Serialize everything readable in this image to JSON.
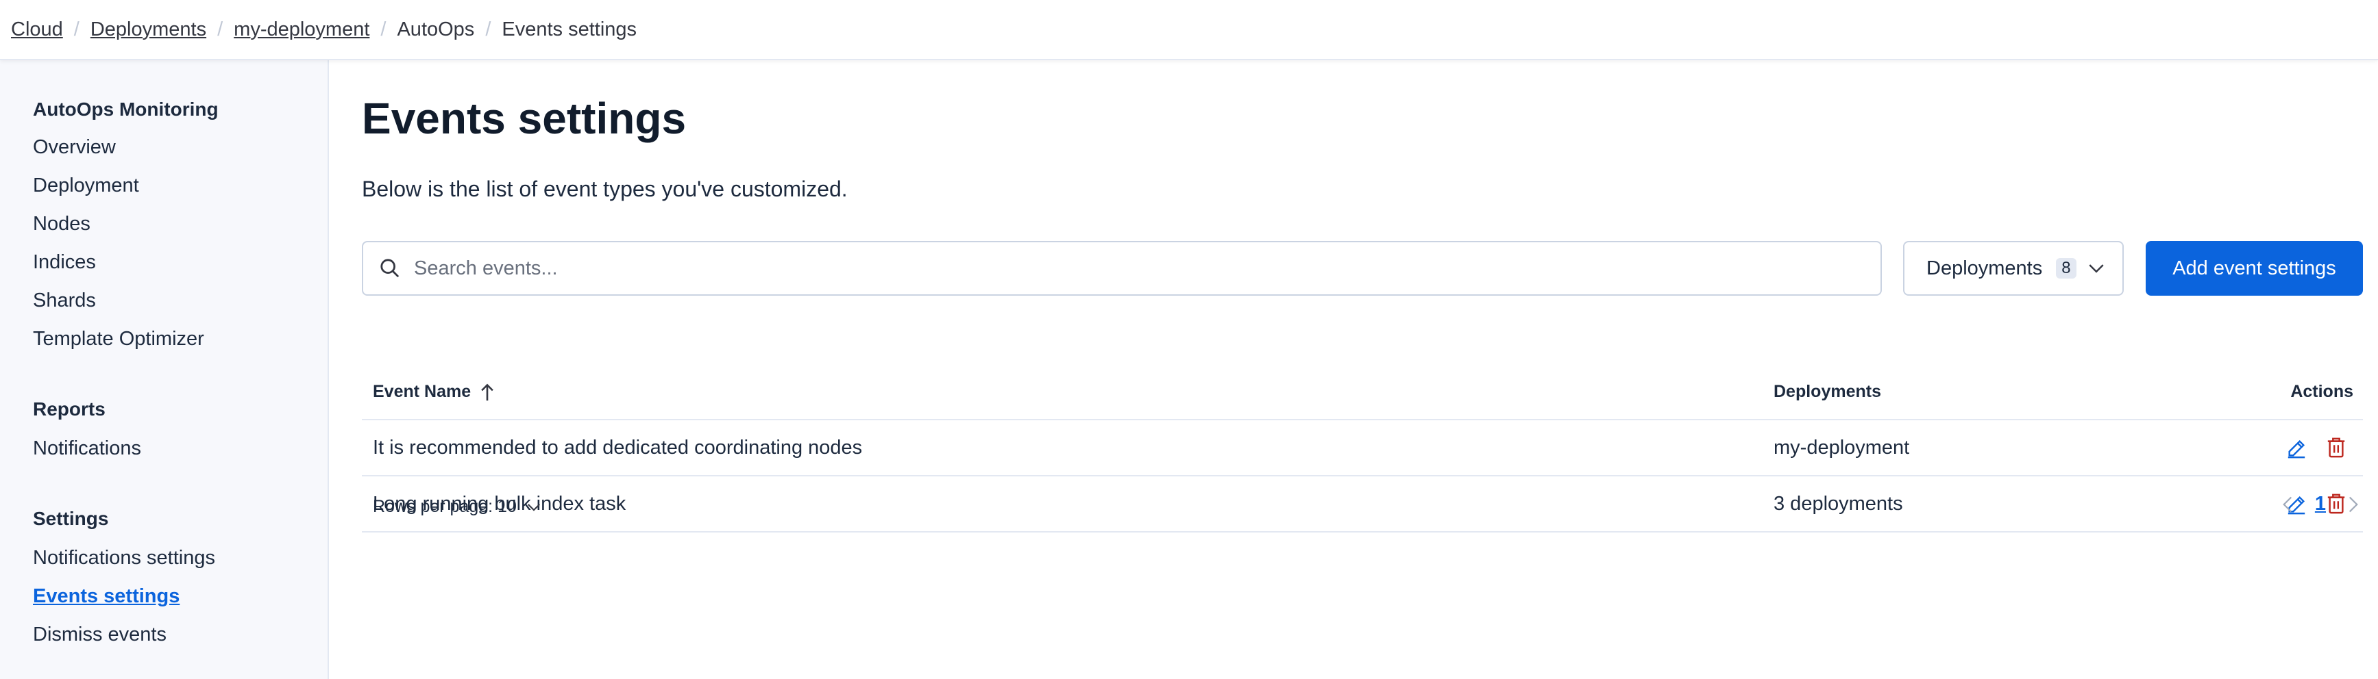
{
  "breadcrumb": [
    {
      "label": "Cloud",
      "link": true
    },
    {
      "label": "Deployments",
      "link": true
    },
    {
      "label": "my-deployment",
      "link": true
    },
    {
      "label": "AutoOps",
      "link": false
    },
    {
      "label": "Events settings",
      "link": false
    }
  ],
  "sidebar": {
    "groups": [
      {
        "title": "AutoOps Monitoring",
        "items": [
          "Overview",
          "Deployment",
          "Nodes",
          "Indices",
          "Shards",
          "Template Optimizer"
        ]
      },
      {
        "title": "Reports",
        "items": [
          "Notifications"
        ]
      },
      {
        "title": "Settings",
        "items": [
          "Notifications settings",
          "Events settings",
          "Dismiss events"
        ]
      }
    ],
    "active_item": "Events settings"
  },
  "main": {
    "title": "Events settings",
    "subtitle": "Below is the list of event types you've customized.",
    "search": {
      "placeholder": "Search events...",
      "value": ""
    },
    "deployments_filter": {
      "label": "Deployments",
      "count": "8"
    },
    "add_button": "Add event settings"
  },
  "table": {
    "columns": {
      "name": "Event Name",
      "deployments": "Deployments",
      "actions": "Actions"
    },
    "sort": {
      "column": "Event Name",
      "direction": "ascending"
    },
    "rows": [
      {
        "name": "It is recommended to add dedicated coordinating nodes",
        "deployments": "my-deployment"
      },
      {
        "name": "Long running bulk index task",
        "deployments": "3 deployments"
      }
    ]
  },
  "pagination": {
    "rows_per_page_label": "Rows per page: 10",
    "current_page": "1"
  },
  "colors": {
    "primary": "#0b64dd",
    "danger": "#bd271e",
    "sidebar_bg": "#f7f8fc",
    "text": "#1d2a3e"
  },
  "icons": {
    "search": "search-icon",
    "chevron": "chevron-down-icon",
    "sort": "arrow-up-icon",
    "edit": "pencil-icon",
    "delete": "trash-icon",
    "prev": "chevron-left-icon",
    "next": "chevron-right-icon"
  }
}
